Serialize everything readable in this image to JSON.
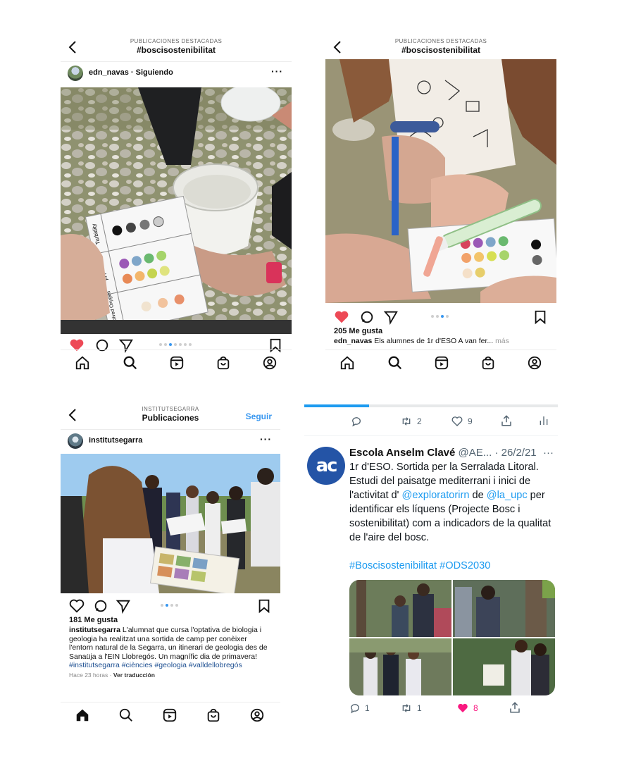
{
  "panel1": {
    "subtitle": "PUBLICACIONES DESTACADAS",
    "title": "#boscisostenibilitat",
    "user": "edn_navas · Siguiendo",
    "more": "···",
    "test_card": {
      "label_top": "Turbidity",
      "label_mid": "pH",
      "label_bottom": "Dissolved Oxygen"
    }
  },
  "panel2": {
    "subtitle": "PUBLICACIONES DESTACADAS",
    "title": "#boscisostenibilitat",
    "likes": "205 Me gusta",
    "caption_user": "edn_navas",
    "caption_text": " Els alumnes de 1r d'ESO A van fer...",
    "more": "más"
  },
  "panel3": {
    "subtitle": "INSTITUTSEGARRA",
    "title": "Publicaciones",
    "follow": "Seguir",
    "user": "institutsegarra",
    "more": "···",
    "likes": "181 Me gusta",
    "caption_user": "institutsegarra",
    "caption_text": " L'alumnat que cursa l'optativa de biologia i geologia ha realitzat una sortida de camp per conèixer l'entorn natural de la Segarra, un itinerari de geologia des de Sanaüja a l'EIN Llobregós. Un magnífic dia de primavera!",
    "caption_tags": "#institutsegarra #ciències #geologia #valldellobregós",
    "time": "Hace 23 horas",
    "translate": "Ver traducción"
  },
  "tweet": {
    "prev_stats": {
      "retweets": "2",
      "likes": "9"
    },
    "name": "Escola Anselm Clavé",
    "handle_date": "@AE... · 26/2/21",
    "more": "···",
    "text_a": "1r d'ESO. Sortida per la Serralada Litoral. Estudi del paisatge mediterrani i inici de l'activitat d' ",
    "mention1": "@exploratorirn",
    "text_b": " de ",
    "mention2": "@la_upc",
    "text_c": " per identificar els líquens (Projecte Bosc i sostenibilitat) com a indicadors de la qualitat de l'aire del bosc.",
    "hashtags": "#Boscisostenibilitat #ODS2030",
    "stats": {
      "replies": "1",
      "retweets": "1",
      "likes": "8"
    },
    "colors": {
      "link": "#1d9bf0",
      "like": "#f91880"
    }
  }
}
